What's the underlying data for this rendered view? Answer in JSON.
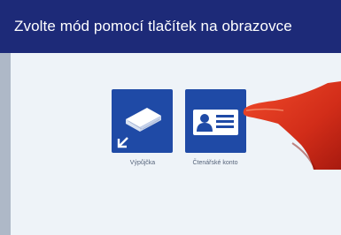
{
  "header": {
    "title": "Zvolte mód pomocí tlačítek na obrazovce"
  },
  "tiles": [
    {
      "label": "Výpůjčka",
      "icon": "book-icon"
    },
    {
      "label": "Čtenářské konto",
      "icon": "id-card-icon"
    }
  ],
  "colors": {
    "header_bg": "#1d2a78",
    "tile_bg": "#1f4aa6",
    "screen_bg": "#eef3f8"
  }
}
